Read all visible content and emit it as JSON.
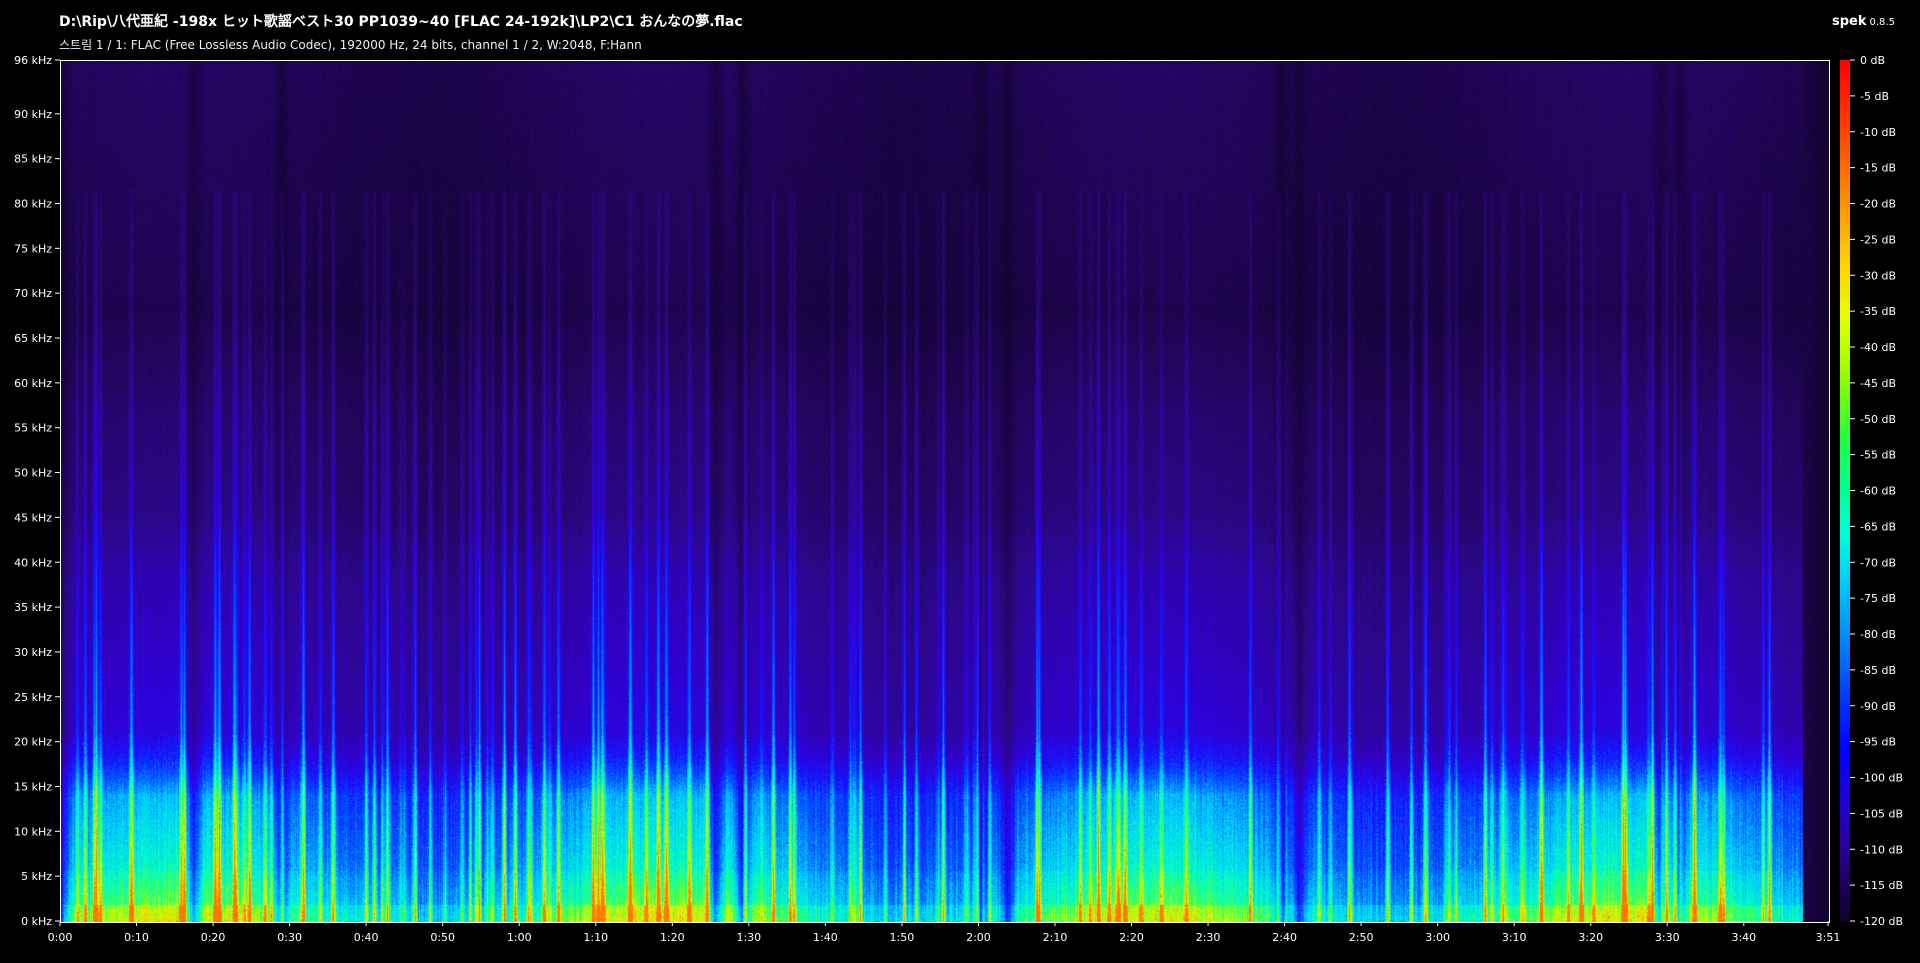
{
  "header": {
    "file_path": "D:\\Rip\\八代亜紀 -198x ヒット歌謡ベスト30 PP1039~40 [FLAC 24-192k]\\LP2\\C1 おんなの夢.flac",
    "stream_info": "스트림 1 / 1: FLAC (Free Lossless Audio Codec), 192000 Hz, 24 bits, channel 1 / 2, W:2048, F:Hann"
  },
  "brand": {
    "name": "spek",
    "version": "0.8.5"
  },
  "freq_axis": {
    "labels": [
      "96 kHz",
      "90 kHz",
      "85 kHz",
      "80 kHz",
      "75 kHz",
      "70 kHz",
      "65 kHz",
      "60 kHz",
      "55 kHz",
      "50 kHz",
      "45 kHz",
      "40 kHz",
      "35 kHz",
      "30 kHz",
      "25 kHz",
      "20 kHz",
      "15 kHz",
      "10 kHz",
      "5 kHz",
      "0 kHz"
    ],
    "values": [
      96,
      90,
      85,
      80,
      75,
      70,
      65,
      60,
      55,
      50,
      45,
      40,
      35,
      30,
      25,
      20,
      15,
      10,
      5,
      0
    ],
    "max": 96
  },
  "time_axis": {
    "labels": [
      "0:00",
      "0:10",
      "0:20",
      "0:30",
      "0:40",
      "0:50",
      "1:00",
      "1:10",
      "1:20",
      "1:30",
      "1:40",
      "1:50",
      "2:00",
      "2:10",
      "2:20",
      "2:30",
      "2:40",
      "2:50",
      "3:00",
      "3:10",
      "3:20",
      "3:30",
      "3:40",
      "3:51"
    ],
    "seconds": [
      0,
      10,
      20,
      30,
      40,
      50,
      60,
      70,
      80,
      90,
      100,
      110,
      120,
      130,
      140,
      150,
      160,
      170,
      180,
      190,
      200,
      210,
      220,
      231
    ],
    "duration": 231
  },
  "db_axis": {
    "labels": [
      "0 dB",
      "-5 dB",
      "-10 dB",
      "-15 dB",
      "-20 dB",
      "-25 dB",
      "-30 dB",
      "-35 dB",
      "-40 dB",
      "-45 dB",
      "-50 dB",
      "-55 dB",
      "-60 dB",
      "-65 dB",
      "-70 dB",
      "-75 dB",
      "-80 dB",
      "-85 dB",
      "-90 dB",
      "-95 dB",
      "-100 dB",
      "-105 dB",
      "-110 dB",
      "-115 dB",
      "-120 dB"
    ],
    "values": [
      0,
      -5,
      -10,
      -15,
      -20,
      -25,
      -30,
      -35,
      -40,
      -45,
      -50,
      -55,
      -60,
      -65,
      -70,
      -75,
      -80,
      -85,
      -90,
      -95,
      -100,
      -105,
      -110,
      -115,
      -120
    ],
    "min": -120
  },
  "colors": {
    "background": "#000000",
    "text": "#ffffff",
    "axis": "#ffffff"
  }
}
